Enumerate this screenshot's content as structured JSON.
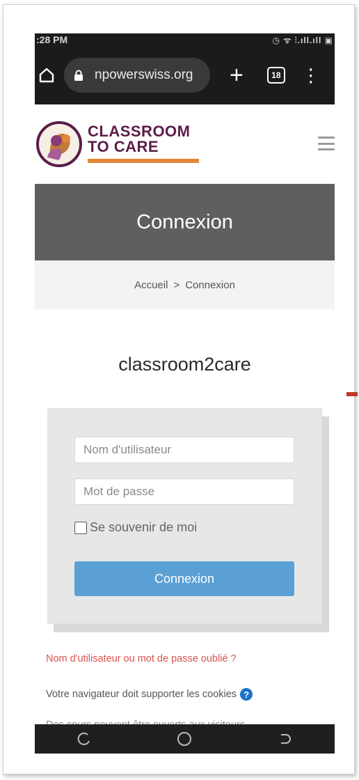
{
  "status_bar": {
    "time": ":28 PM",
    "right_icons": "◷ ᯤ ⫶.ıll.ıll ▣"
  },
  "browser": {
    "url": "npowerswiss.org",
    "tab_count": "18"
  },
  "site": {
    "brand_line1": "CLASSROOM",
    "brand_line2": "TO CARE"
  },
  "page": {
    "banner_title": "Connexion",
    "breadcrumb": [
      "Accueil",
      "Connexion"
    ],
    "site_name": "classroom2care"
  },
  "login_form": {
    "username_placeholder": "Nom d'utilisateur",
    "password_placeholder": "Mot de passe",
    "remember_label": "Se souvenir de moi",
    "submit_label": "Connexion"
  },
  "links": {
    "forgot": "Nom d'utilisateur ou mot de passe oublié ?",
    "cookies_notice": "Votre navigateur doit supporter les cookies",
    "guests_notice": "Des cours peuvent être ouverts aux visiteurs"
  },
  "colors": {
    "brand": "#5b1d4a",
    "accent": "#e3873a",
    "button": "#5aa0d4",
    "link_red": "#d9534f"
  }
}
